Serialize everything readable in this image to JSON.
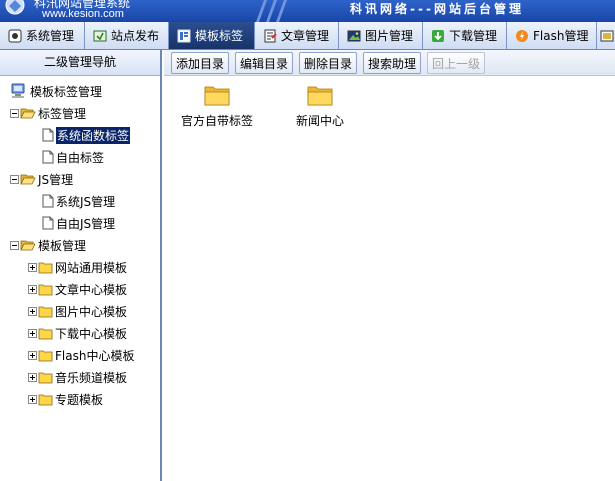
{
  "header": {
    "brand_title": "科汛网站管理系统",
    "brand_url": "www.kesion.com",
    "slogan": "科讯网络---网站后台管理"
  },
  "topnav": {
    "items": [
      {
        "label": "系统管理",
        "icon": "system-icon"
      },
      {
        "label": "站点发布",
        "icon": "publish-icon"
      },
      {
        "label": "模板标签",
        "icon": "template-icon",
        "active": true
      },
      {
        "label": "文章管理",
        "icon": "article-icon"
      },
      {
        "label": "图片管理",
        "icon": "picture-icon"
      },
      {
        "label": "下载管理",
        "icon": "download-icon"
      },
      {
        "label": "Flash管理",
        "icon": "flash-icon"
      }
    ]
  },
  "sidebar": {
    "title": "二级管理导航",
    "tree": {
      "root": "模板标签管理",
      "groups": [
        {
          "label": "标签管理",
          "children": [
            "系统函数标签",
            "自由标签"
          ],
          "selected": "系统函数标签"
        },
        {
          "label": "JS管理",
          "children": [
            "系统JS管理",
            "自由JS管理"
          ]
        },
        {
          "label": "模板管理",
          "children": [
            "网站通用模板",
            "文章中心模板",
            "图片中心模板",
            "下载中心模板",
            "Flash中心模板",
            "音乐频道模板",
            "专题模板"
          ]
        }
      ]
    }
  },
  "toolbar": {
    "add_dir": "添加目录",
    "edit_dir": "编辑目录",
    "delete_dir": "删除目录",
    "search_helper": "搜索助理",
    "up_level": "回上一级"
  },
  "content": {
    "folders": [
      {
        "name": "官方自带标签"
      },
      {
        "name": "新闻中心"
      }
    ]
  },
  "colors": {
    "banner": "#1e4fb5",
    "nav_active": "#1f3f7e",
    "selection": "#0a246a",
    "folder": "#f5c84a"
  }
}
